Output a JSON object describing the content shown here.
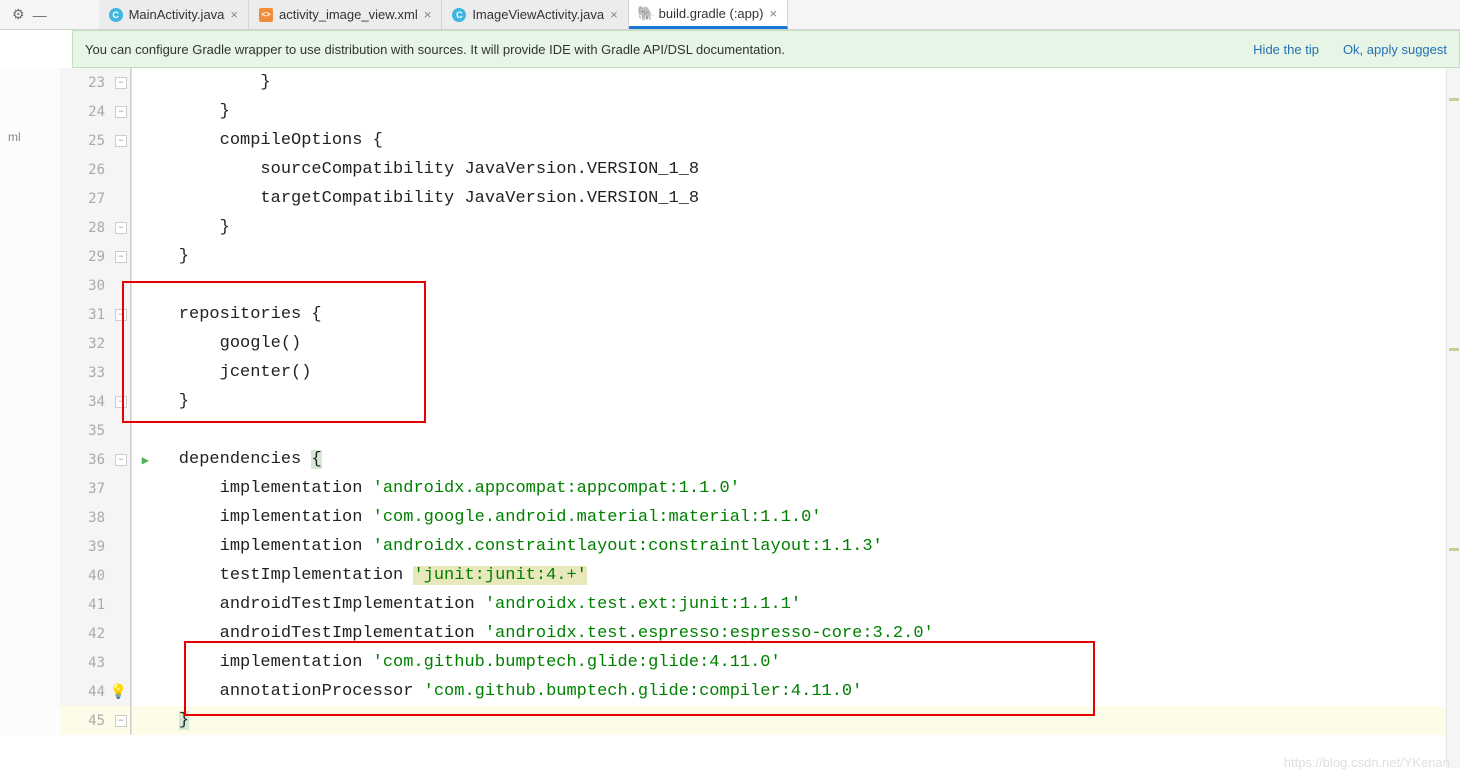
{
  "tabs": [
    {
      "label": "MainActivity.java",
      "type": "java"
    },
    {
      "label": "activity_image_view.xml",
      "type": "xml"
    },
    {
      "label": "ImageViewActivity.java",
      "type": "java"
    },
    {
      "label": "build.gradle (:app)",
      "type": "gradle",
      "active": true
    }
  ],
  "tip": {
    "text": "You can configure Gradle wrapper to use distribution with sources. It will provide IDE with Gradle API/DSL documentation.",
    "hide": "Hide the tip",
    "apply": "Ok, apply suggest"
  },
  "left_label": "ml",
  "lines": {
    "start": 23,
    "rows": [
      {
        "n": 23,
        "code": "            }"
      },
      {
        "n": 24,
        "code": "        }"
      },
      {
        "n": 25,
        "code": "        compileOptions {"
      },
      {
        "n": 26,
        "code": "            sourceCompatibility JavaVersion.VERSION_1_8"
      },
      {
        "n": 27,
        "code": "            targetCompatibility JavaVersion.VERSION_1_8"
      },
      {
        "n": 28,
        "code": "        }"
      },
      {
        "n": 29,
        "code": "    }"
      },
      {
        "n": 30,
        "code": ""
      },
      {
        "n": 31,
        "code": "    repositories {"
      },
      {
        "n": 32,
        "code": "        google()"
      },
      {
        "n": 33,
        "code": "        jcenter()"
      },
      {
        "n": 34,
        "code": "    }"
      },
      {
        "n": 35,
        "code": ""
      },
      {
        "n": 36,
        "code": "    dependencies {",
        "run": true
      },
      {
        "n": 37,
        "code": "        implementation ",
        "s": "'androidx.appcompat:appcompat:1.1.0'"
      },
      {
        "n": 38,
        "code": "        implementation ",
        "s": "'com.google.android.material:material:1.1.0'"
      },
      {
        "n": 39,
        "code": "        implementation ",
        "s": "'androidx.constraintlayout:constraintlayout:1.1.3'"
      },
      {
        "n": 40,
        "code": "        testImplementation ",
        "shl": "'junit:junit:4.+'"
      },
      {
        "n": 41,
        "code": "        androidTestImplementation ",
        "s": "'androidx.test.ext:junit:1.1.1'"
      },
      {
        "n": 42,
        "code": "        androidTestImplementation ",
        "s": "'androidx.test.espresso:espresso-core:3.2.0'"
      },
      {
        "n": 43,
        "code": "        implementation ",
        "s": "'com.github.bumptech.glide:glide:4.11.0'"
      },
      {
        "n": 44,
        "code": "        annotationProcessor ",
        "s": "'com.github.bumptech.glide:compiler:4.11.0'",
        "bulb": true
      },
      {
        "n": 45,
        "code": "    }",
        "current": true,
        "braceHl": true
      }
    ]
  },
  "watermark": "https://blog.csdn.net/YKenan"
}
